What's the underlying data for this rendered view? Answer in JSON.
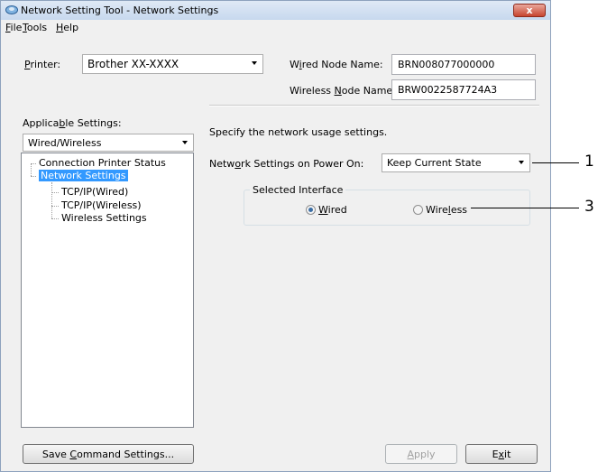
{
  "window": {
    "title": "Network Setting Tool - Network Settings",
    "close_label": "x"
  },
  "menu": {
    "file": {
      "mnemonic": "F",
      "rest": "ile"
    },
    "tools": {
      "mnemonic": "T",
      "rest": "ools"
    },
    "help": {
      "mnemonic": "H",
      "rest": "elp"
    }
  },
  "printer": {
    "label_mnemonic": "P",
    "label_rest": "rinter:",
    "value": "Brother XX-XXXX"
  },
  "wired_node": {
    "label_a": "W",
    "label_mnemonic": "i",
    "label_b": "red Node Name:",
    "value": "BRN008077000000"
  },
  "wireless_node": {
    "label_a": "Wireless ",
    "label_mnemonic": "N",
    "label_b": "ode Name:",
    "value": "BRW0022587724A3"
  },
  "applicable": {
    "label_a": "Applica",
    "label_mnemonic": "b",
    "label_b": "le Settings:",
    "value": "Wired/Wireless"
  },
  "tree": {
    "items": [
      {
        "label": "Connection Printer Status"
      },
      {
        "label": "Network Settings",
        "selected": true
      },
      {
        "label": "TCP/IP(Wired)"
      },
      {
        "label": "TCP/IP(Wireless)"
      },
      {
        "label": "Wireless Settings"
      }
    ]
  },
  "main": {
    "description": "Specify the network usage settings.",
    "power_on_label_a": "Netw",
    "power_on_label_mnemonic": "o",
    "power_on_label_b": "rk Settings on Power On:",
    "power_on_value": "Keep Current State",
    "group_label": "Selected Interface",
    "radio_wired_mnemonic": "W",
    "radio_wired_rest": "ired",
    "radio_wireless_a": "Wire",
    "radio_wireless_mnemonic": "l",
    "radio_wireless_b": "ess",
    "selected_interface": "Wired"
  },
  "buttons": {
    "save_a": "Save ",
    "save_mnemonic": "C",
    "save_b": "ommand Settings...",
    "apply_mnemonic": "A",
    "apply_rest": "pply",
    "exit_a": "E",
    "exit_mnemonic": "x",
    "exit_b": "it"
  },
  "callouts": {
    "one": "1",
    "three": "3"
  },
  "colors": {
    "selection": "#3399ff",
    "window_bg": "#f0f0f0"
  }
}
